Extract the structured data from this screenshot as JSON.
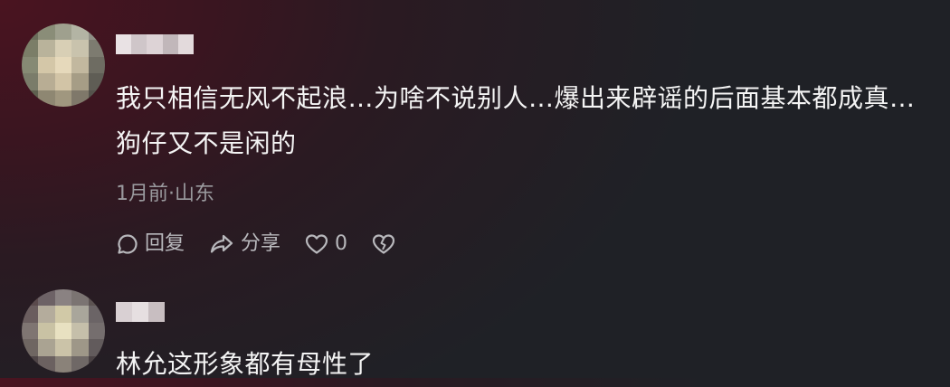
{
  "comments": [
    {
      "text": "我只相信无风不起浪…为啥不说别人…爆出来辟谣的后面基本都成真…狗仔又不是闲的",
      "meta": "1月前·山东",
      "actions": {
        "reply_label": "回复",
        "share_label": "分享",
        "like_count": "0"
      }
    },
    {
      "text": "林允这形象都有母性了"
    }
  ],
  "colors": {
    "text": "#f4f4f4",
    "meta": "#9a9a9e",
    "actions": "#b8b8bc"
  }
}
